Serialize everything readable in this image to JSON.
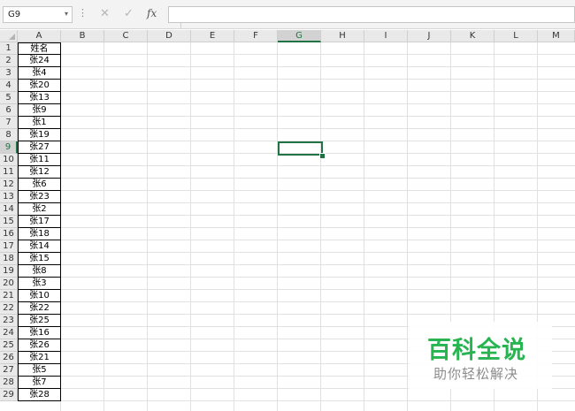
{
  "formula_bar": {
    "name_box_value": "G9",
    "name_box_arrow": "▾",
    "more_icon": "⋮",
    "cancel_icon": "✕",
    "enter_icon": "✓",
    "insert_function_label": "fx",
    "formula_value": ""
  },
  "columns": [
    "A",
    "B",
    "C",
    "D",
    "E",
    "F",
    "G",
    "H",
    "I",
    "J",
    "K",
    "L",
    "M"
  ],
  "selected_column": "G",
  "rows": [
    "1",
    "2",
    "3",
    "4",
    "5",
    "6",
    "7",
    "8",
    "9",
    "10",
    "11",
    "12",
    "13",
    "14",
    "15",
    "16",
    "17",
    "18",
    "19",
    "20",
    "21",
    "22",
    "23",
    "24",
    "25",
    "26",
    "27",
    "28",
    "29"
  ],
  "selected_row": "9",
  "active_cell": "G9",
  "column_a_values": [
    "姓名",
    "张24",
    "张4",
    "张20",
    "张13",
    "张9",
    "张1",
    "张19",
    "张27",
    "张11",
    "张12",
    "张6",
    "张23",
    "张2",
    "张17",
    "张18",
    "张14",
    "张15",
    "张8",
    "张3",
    "张10",
    "张22",
    "张25",
    "张16",
    "张26",
    "张21",
    "张5",
    "张7",
    "张28"
  ],
  "watermark": {
    "title": "百科全说",
    "subtitle": "助你轻松解决",
    "title_color": "#20b24a"
  },
  "colors": {
    "accent": "#217346",
    "gridline": "#e1e1e1",
    "header_bg": "#e9e9e9"
  }
}
